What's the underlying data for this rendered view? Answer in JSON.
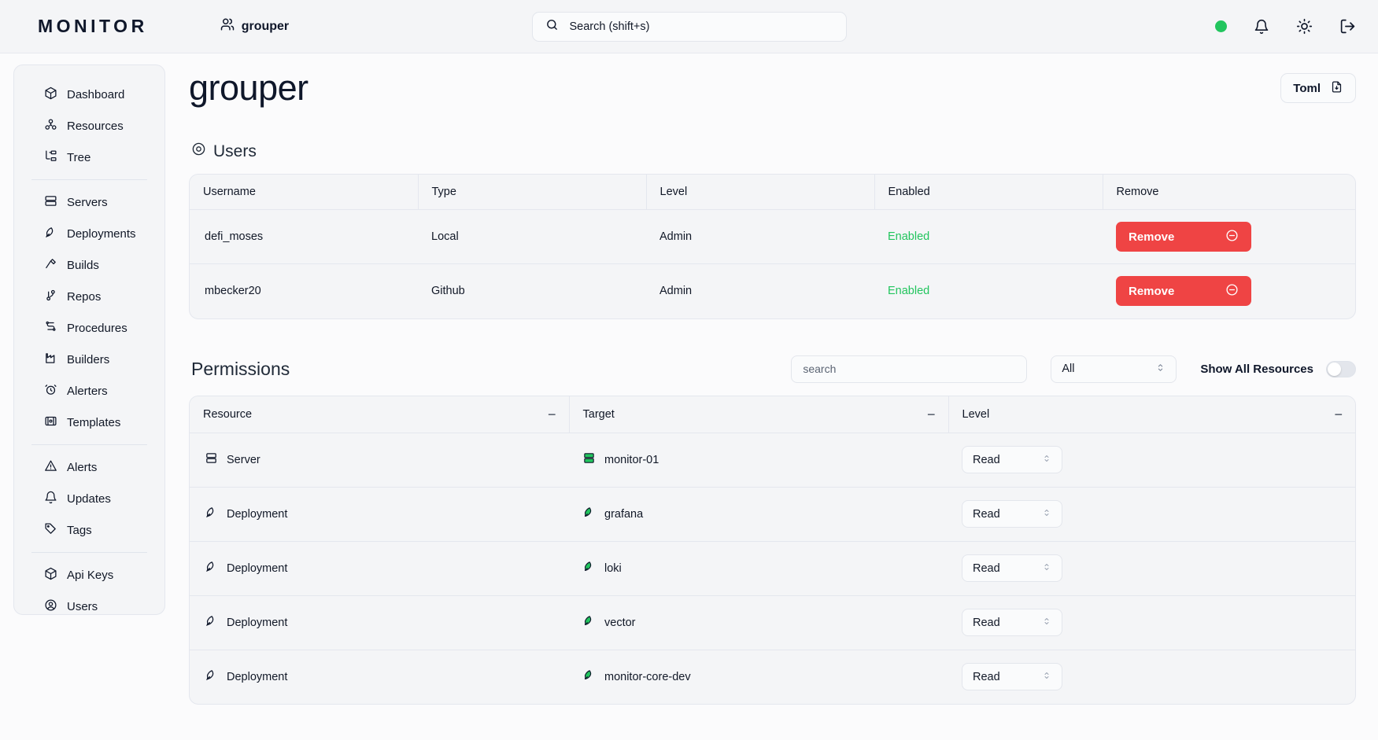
{
  "topbar": {
    "brand": "MONITOR",
    "group_label": "grouper",
    "group_icon": "users-icon",
    "search_placeholder": "Search (shift+s)",
    "search_icon": "search-icon",
    "status_dot_color": "#22c55e",
    "icons": [
      "status-dot",
      "bell-icon",
      "sun-icon",
      "logout-icon"
    ]
  },
  "sidebar": {
    "groups": [
      {
        "items": [
          {
            "label": "Dashboard",
            "icon": "box-icon"
          },
          {
            "label": "Resources",
            "icon": "resources-icon"
          },
          {
            "label": "Tree",
            "icon": "tree-icon"
          }
        ]
      },
      {
        "items": [
          {
            "label": "Servers",
            "icon": "server-icon"
          },
          {
            "label": "Deployments",
            "icon": "rocket-icon"
          },
          {
            "label": "Builds",
            "icon": "hammer-icon"
          },
          {
            "label": "Repos",
            "icon": "git-branch-icon"
          },
          {
            "label": "Procedures",
            "icon": "procedures-icon"
          },
          {
            "label": "Builders",
            "icon": "factory-icon"
          },
          {
            "label": "Alerters",
            "icon": "alarm-clock-icon"
          },
          {
            "label": "Templates",
            "icon": "template-icon"
          }
        ]
      },
      {
        "items": [
          {
            "label": "Alerts",
            "icon": "warning-triangle-icon"
          },
          {
            "label": "Updates",
            "icon": "bell-icon"
          },
          {
            "label": "Tags",
            "icon": "tag-icon"
          }
        ]
      },
      {
        "items": [
          {
            "label": "Api Keys",
            "icon": "box-icon"
          },
          {
            "label": "Users",
            "icon": "user-circle-icon"
          }
        ]
      }
    ]
  },
  "page": {
    "title": "grouper",
    "toml_button": {
      "label": "Toml",
      "icon": "file-download-icon"
    }
  },
  "users_section": {
    "heading": "Users",
    "heading_icon": "user-circle-icon",
    "columns": [
      "Username",
      "Type",
      "Level",
      "Enabled",
      "Remove"
    ],
    "rows": [
      {
        "username": "defi_moses",
        "type": "Local",
        "level": "Admin",
        "enabled": "Enabled",
        "remove_label": "Remove",
        "remove_icon": "minus-circle-icon"
      },
      {
        "username": "mbecker20",
        "type": "Github",
        "level": "Admin",
        "enabled": "Enabled",
        "remove_label": "Remove",
        "remove_icon": "minus-circle-icon"
      }
    ],
    "enabled_color": "#22c55e",
    "remove_button_color": "#ef4444"
  },
  "permissions_section": {
    "heading": "Permissions",
    "search_placeholder": "search",
    "search_value": "",
    "filter_value": "All",
    "toggle_label": "Show All Resources",
    "toggle_on": false,
    "columns": [
      "Resource",
      "Target",
      "Level"
    ],
    "sort_indicator": "−",
    "rows": [
      {
        "resource": "Server",
        "resource_icon": "server-icon",
        "target": "monitor-01",
        "target_icon": "server-icon-green",
        "level": "Read"
      },
      {
        "resource": "Deployment",
        "resource_icon": "rocket-icon",
        "target": "grafana",
        "target_icon": "rocket-icon-green",
        "level": "Read"
      },
      {
        "resource": "Deployment",
        "resource_icon": "rocket-icon",
        "target": "loki",
        "target_icon": "rocket-icon-green",
        "level": "Read"
      },
      {
        "resource": "Deployment",
        "resource_icon": "rocket-icon",
        "target": "vector",
        "target_icon": "rocket-icon-green",
        "level": "Read"
      },
      {
        "resource": "Deployment",
        "resource_icon": "rocket-icon",
        "target": "monitor-core-dev",
        "target_icon": "rocket-icon-green",
        "level": "Read"
      }
    ]
  }
}
